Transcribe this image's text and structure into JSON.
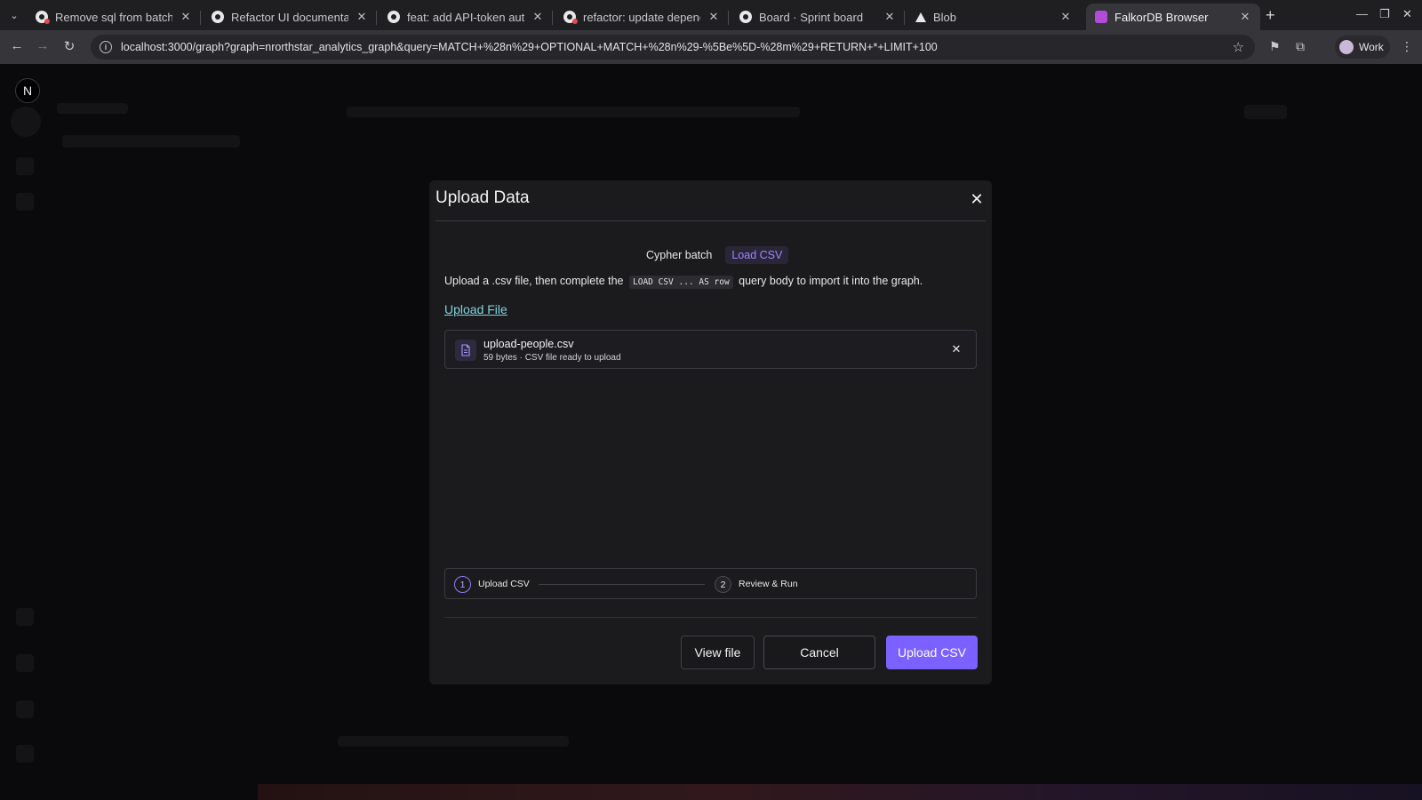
{
  "browser": {
    "tabs": [
      {
        "title": "Remove sql from batch c",
        "icon": "github-red-icon"
      },
      {
        "title": "Refactor UI documentati",
        "icon": "github-icon"
      },
      {
        "title": "feat: add API-token auth",
        "icon": "github-icon"
      },
      {
        "title": "refactor: update depend",
        "icon": "github-red-icon"
      },
      {
        "title": "Board · Sprint board",
        "icon": "github-icon"
      },
      {
        "title": "Blob",
        "icon": "vercel-icon"
      },
      {
        "title": "FalkorDB Browser",
        "icon": "falkordb-icon"
      }
    ],
    "url": "localhost:3000/graph?graph=nrorthstar_analytics_graph&query=MATCH+%28n%29+OPTIONAL+MATCH+%28n%29-%5Be%5D-%28m%29+RETURN+*+LIMIT+100",
    "profile_label": "Work"
  },
  "app": {
    "logo_letter": "N"
  },
  "modal": {
    "title": "Upload Data",
    "modes": {
      "cypher": "Cypher batch",
      "csv": "Load CSV"
    },
    "description": {
      "before": "Upload a .csv file, then complete the",
      "code": "LOAD CSV ... AS row",
      "after": "query body to import it into the graph."
    },
    "upload_link": "Upload File",
    "file": {
      "name": "upload-people.csv",
      "meta": "59 bytes · CSV file ready to upload"
    },
    "steps": [
      {
        "num": "1",
        "label": "Upload CSV"
      },
      {
        "num": "2",
        "label": "Review & Run"
      }
    ],
    "buttons": {
      "view": "View file",
      "cancel": "Cancel",
      "upload": "Upload CSV"
    }
  },
  "colors": {
    "accent": "#7b61ff",
    "link": "#7fd3dc",
    "modal_bg": "#1b1b1e"
  }
}
